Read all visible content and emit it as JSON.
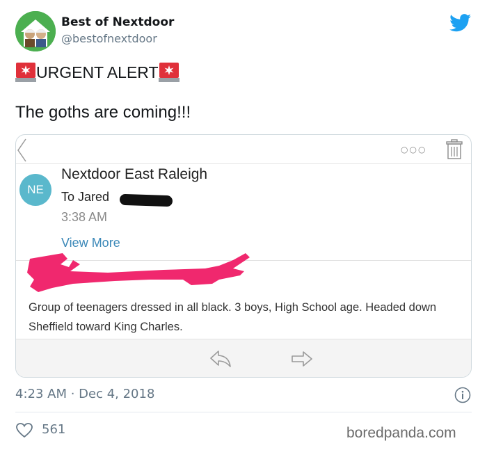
{
  "author": {
    "name": "Best of Nextdoor",
    "handle": "@bestofnextdoor"
  },
  "tweet": {
    "line1": "URGENT ALERT",
    "line2": "The goths are coming!!!",
    "timestamp": "4:23 AM · Dec 4, 2018",
    "likes": "561"
  },
  "email": {
    "avatar_initials": "NE",
    "sender": "Nextdoor East Raleigh",
    "recipient": "To Jared",
    "time": "3:38 AM",
    "view_more": "View More",
    "body": "Group of teenagers dressed in all black. 3 boys, High School age. Headed down Sheffield toward King Charles."
  },
  "icons": {
    "twitter": "twitter-bird-icon",
    "siren": "police-siren-icon",
    "trash": "trash-icon",
    "reply": "reply-icon",
    "forward": "forward-icon",
    "info": "info-icon",
    "heart": "heart-icon",
    "back": "back-chevron-icon",
    "more": "more-options-icon"
  },
  "watermark": "boredpanda.com",
  "colors": {
    "twitter_blue": "#1da1f2",
    "ne_avatar": "#5ab8cc",
    "link_blue": "#3b88b8",
    "redaction_pink": "#f0286e",
    "muted_text": "#657786"
  }
}
